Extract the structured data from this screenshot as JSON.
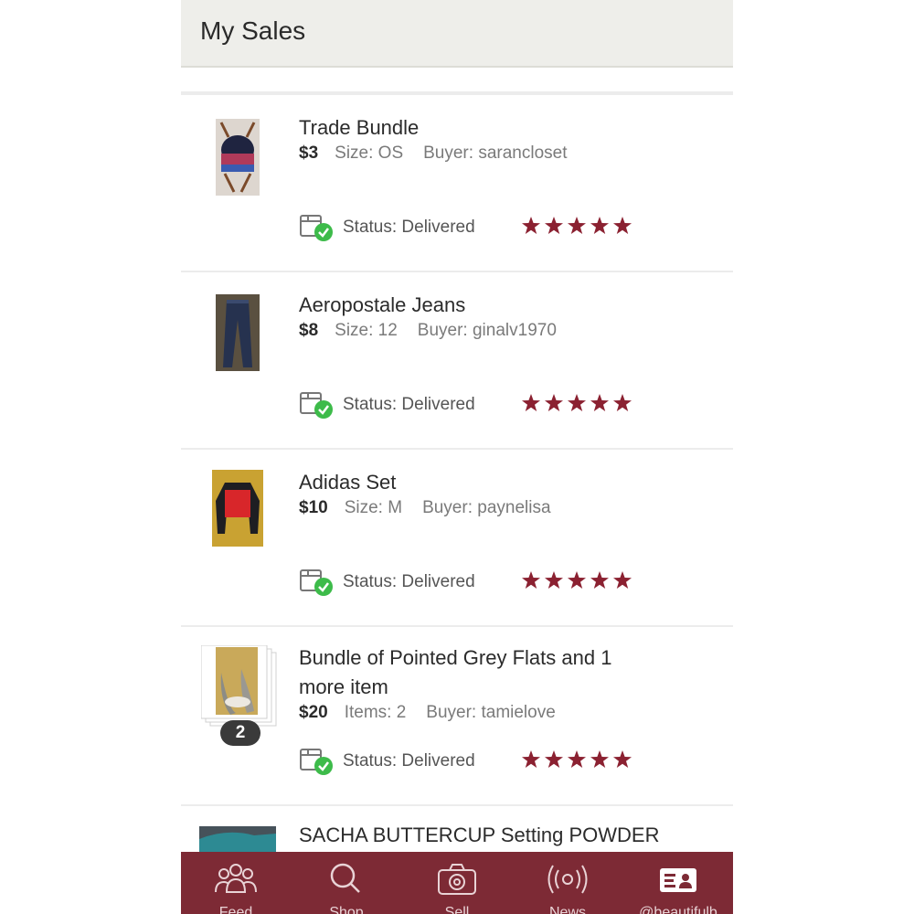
{
  "header": {
    "title": "My Sales"
  },
  "sales": [
    {
      "title_line1": "Trade Bundle",
      "price": "$3",
      "detail": "Size: OS",
      "buyer": "Buyer: sarancloset",
      "status": "Status:  Delivered",
      "rating": 5
    },
    {
      "title_line1": "Aeropostale Jeans",
      "price": "$8",
      "detail": "Size: 12",
      "buyer": "Buyer: ginalv1970",
      "status": "Status:  Delivered",
      "rating": 5
    },
    {
      "title_line1": "Adidas Set",
      "price": "$10",
      "detail": "Size: M",
      "buyer": "Buyer: paynelisa",
      "status": "Status:  Delivered",
      "rating": 5
    },
    {
      "title_line1": "Bundle of Pointed Grey Flats and 1",
      "title_line2": "more item",
      "price": "$20",
      "detail": "Items: 2",
      "buyer": "Buyer: tamielove",
      "status": "Status:  Delivered",
      "rating": 5,
      "bundle_count": "2"
    },
    {
      "title_line1": "SACHA BUTTERCUP Setting POWDER"
    }
  ],
  "icons": {
    "status": "package-delivered-check-icon",
    "star": "star-icon"
  },
  "nav": [
    {
      "label": "Feed",
      "icon": "people-icon"
    },
    {
      "label": "Shop",
      "icon": "search-icon"
    },
    {
      "label": "Sell",
      "icon": "camera-icon"
    },
    {
      "label": "News",
      "icon": "broadcast-icon"
    },
    {
      "label": "@beautifulb",
      "icon": "profile-card-icon"
    }
  ],
  "colors": {
    "accent": "#7d2a35",
    "star": "#8b2131",
    "check": "#3dbb4a",
    "header_bg": "#eeeeea"
  }
}
